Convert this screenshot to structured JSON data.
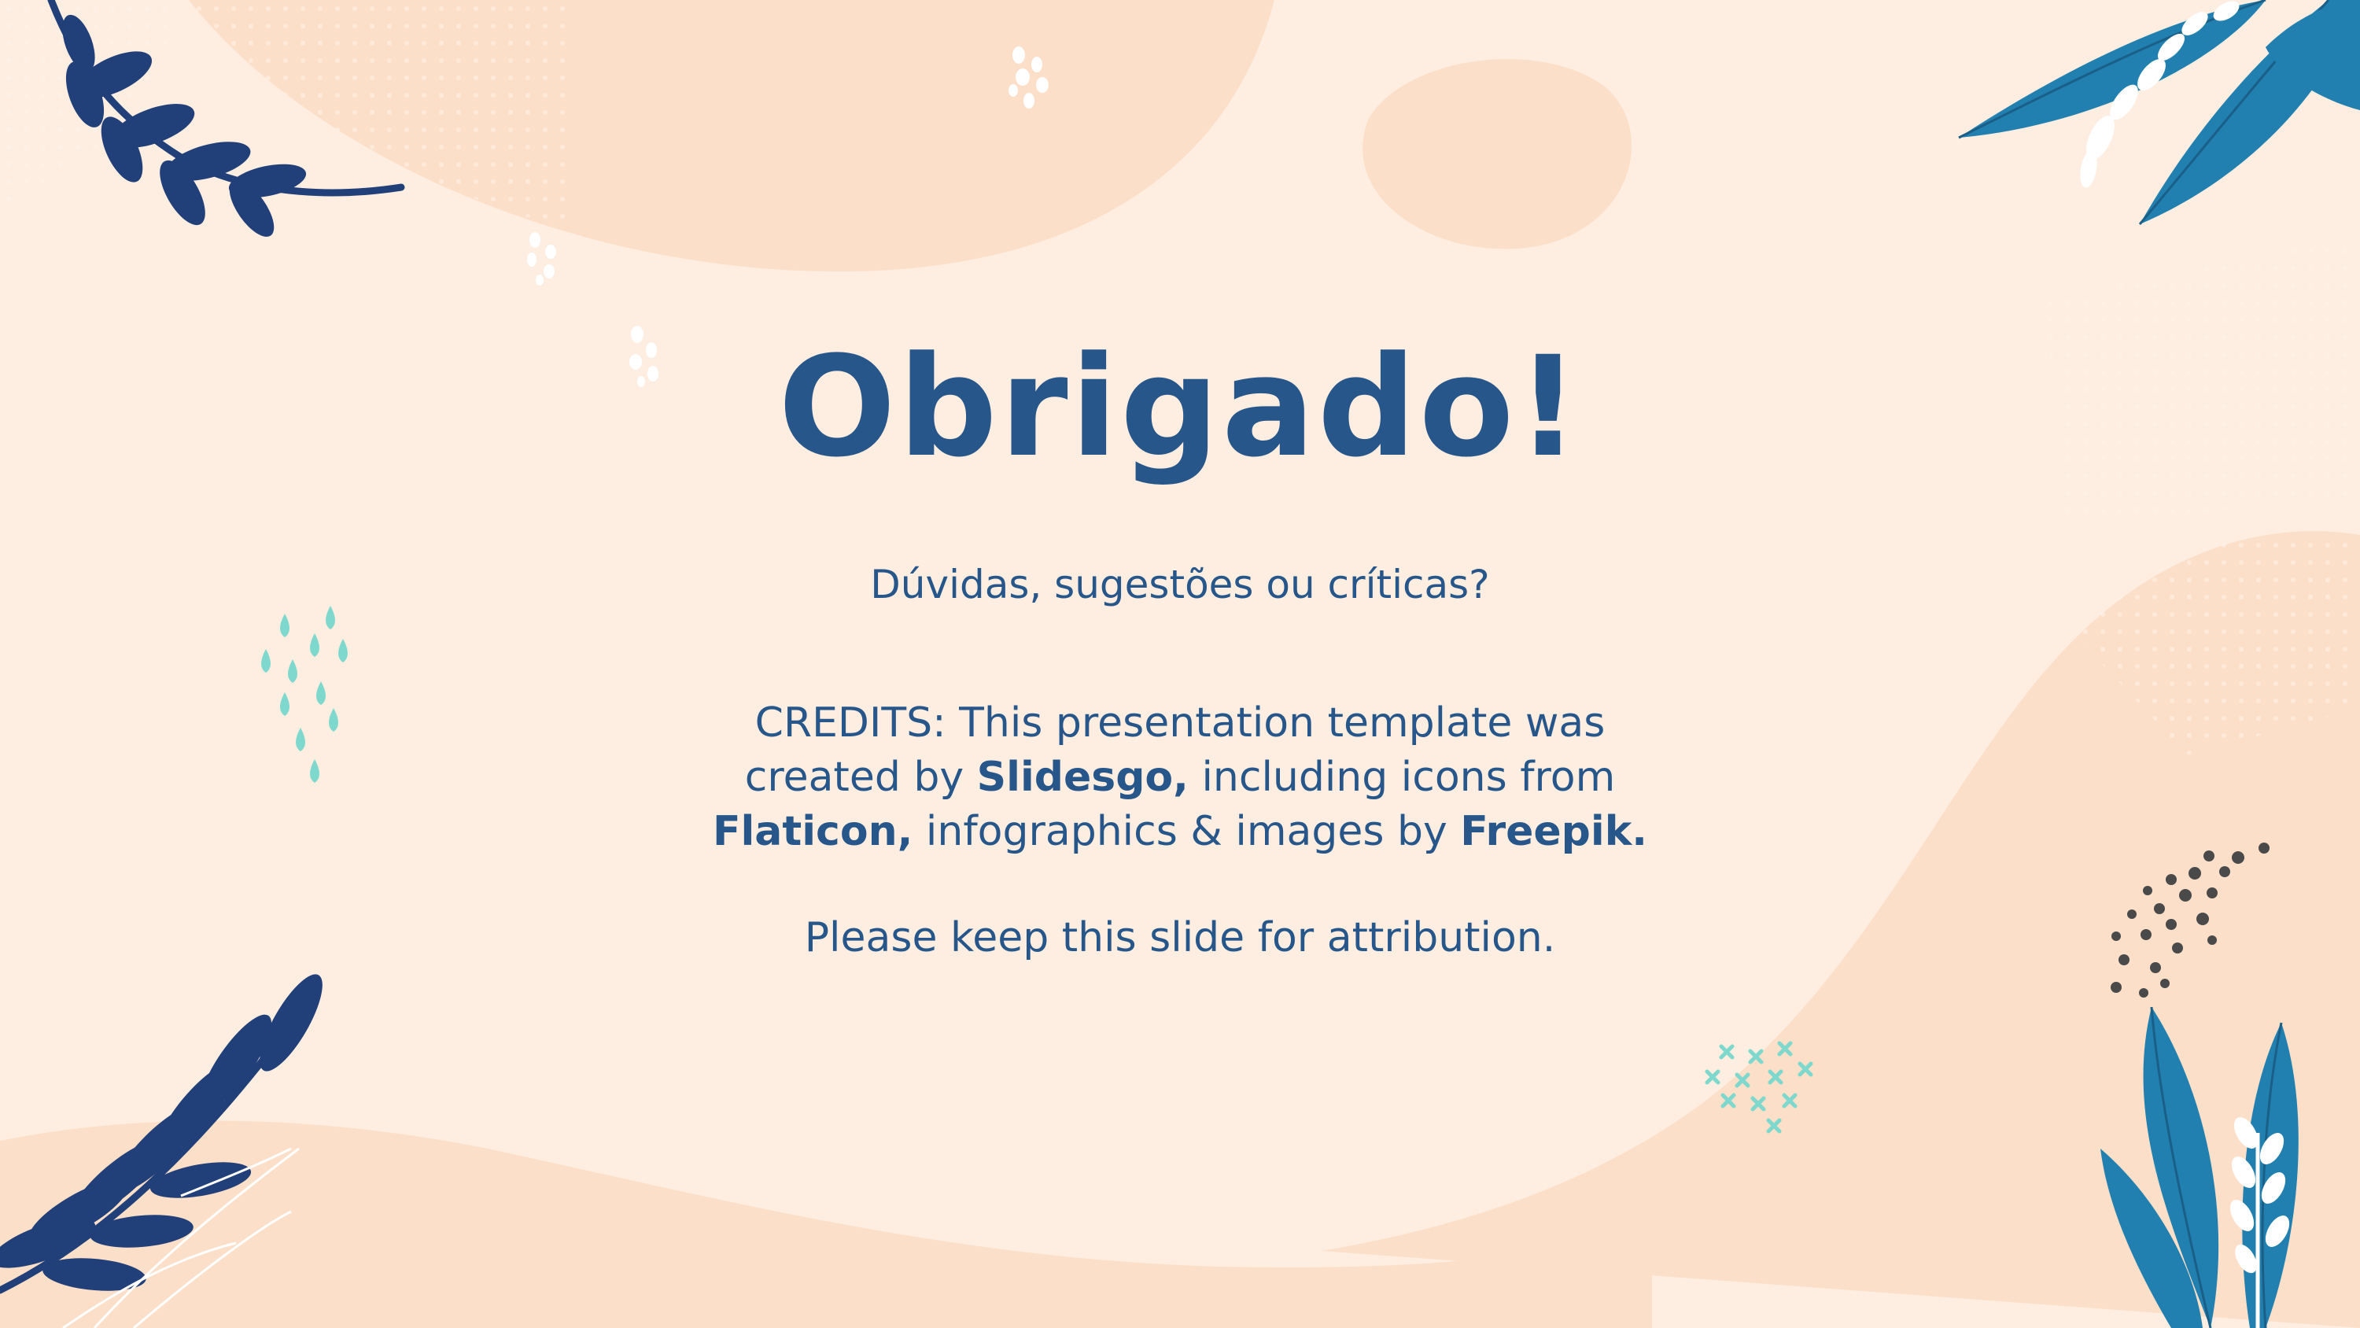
{
  "slide": {
    "title": "Obrigado!",
    "subtitle": "Dúvidas, sugestões ou críticas?",
    "credits": {
      "part1": "CREDITS: This presentation template was created by ",
      "slidesgo": "Slidesgo,",
      "part2": " including icons from ",
      "flaticon": "Flaticon,",
      "part3": " infographics & images by ",
      "freepik": "Freepik."
    },
    "attribution": "Please keep this slide for attribution."
  },
  "colors": {
    "background": "#fdeee1",
    "blob": "#fcdfc8",
    "text": "#27568a",
    "navy_leaf": "#213f78",
    "teal_leaf": "#2280b0",
    "mint": "#7fd8cd",
    "dots_dark": "#4a4a4a"
  },
  "icons": [
    "leaf-branch-top-left-icon",
    "leaf-cluster-top-right-icon",
    "leaf-branch-bottom-left-icon",
    "leaf-cluster-bottom-right-icon",
    "raindrops-icon",
    "dot-cluster-icon",
    "cross-pattern-icon"
  ]
}
